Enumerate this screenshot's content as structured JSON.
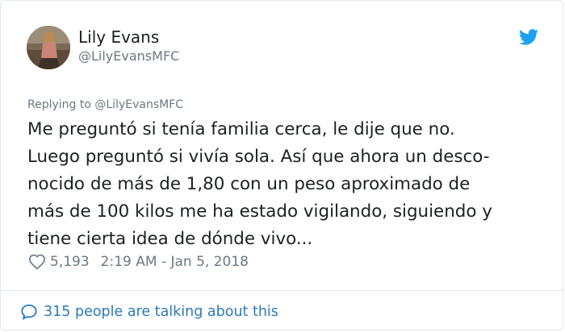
{
  "author": {
    "name": "Lily Evans",
    "handle": "@LilyEvansMFC",
    "avatar_icon": "profile-photo"
  },
  "reply": {
    "text": "Replying to @LilyEvansMFC"
  },
  "tweet": {
    "lines": [
      "Me preguntó si tenía familia cerca, le dije que no.",
      "Luego preguntó si vivía sola. Así que ahora un desco-",
      "nocido de más de 1,80 con un peso aproximado de",
      "más de 100 kilos me ha estado vigilando, siguiendo y",
      "tiene cierta idea de dónde vivo..."
    ]
  },
  "meta": {
    "likes": "5,193",
    "timestamp": "2:19 AM - Jan 5, 2018"
  },
  "footer": {
    "talk_text": "315 people are talking about this"
  },
  "colors": {
    "brand": "#1da1f2",
    "link": "#2b7bb9",
    "muted": "#697882",
    "text": "#1c2022"
  }
}
